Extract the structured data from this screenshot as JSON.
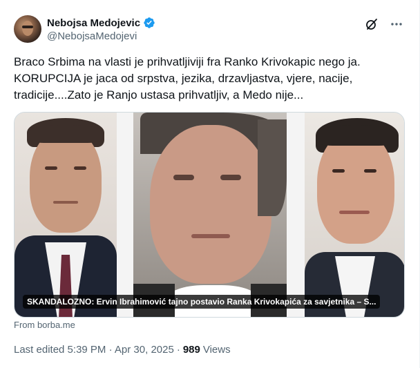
{
  "author": {
    "display_name": "Nebojsa Medojevic",
    "handle": "@NebojsaMedojevi",
    "verified_color": "#1d9bf0"
  },
  "actions": {
    "grok_icon": "grok-icon",
    "more_icon": "more-icon"
  },
  "tweet": {
    "text": "Braco Srbima na vlasti je prihvatljiviji fra Ranko Krivokapic nego ja.\nKORUPCIJA je jaca od srpstva, jezika, drzavljastva, vjere, nacije,\ntradicije....Zato je Ranjo ustasa prihvatljiv, a Medo nije..."
  },
  "link_card": {
    "caption": "SKANDALOZNO: Ervin Ibrahimović tajno postavio Ranka Krivokapića za savjetnika – S...",
    "source": "From borba.me"
  },
  "meta": {
    "edited": "Last edited 5:39 PM · Apr 30, 2025",
    "separator": "·",
    "views_count": "989",
    "views_label": "Views"
  }
}
